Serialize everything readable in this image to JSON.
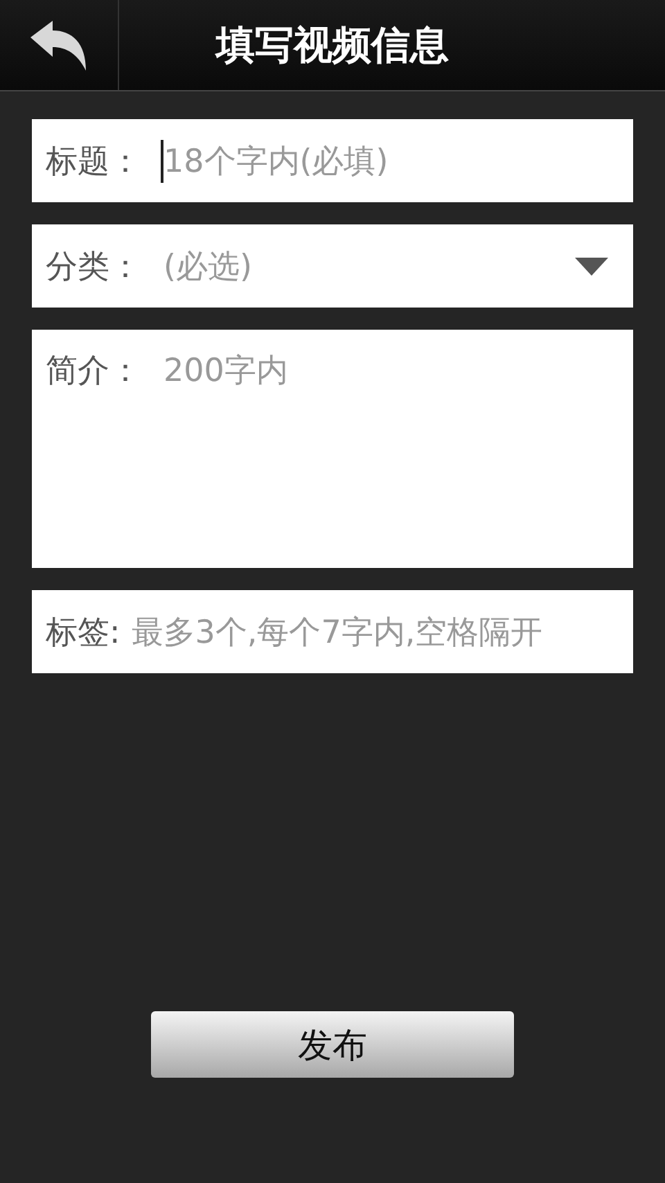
{
  "header": {
    "title": "填写视频信息"
  },
  "fields": [
    {
      "kind": "text",
      "label": "标题：",
      "placeholder": "18个字内(必填)",
      "focused": true
    },
    {
      "kind": "select",
      "label": "分类：",
      "placeholder": "(必选)",
      "focused": false
    },
    {
      "kind": "textarea",
      "label": "简介：",
      "placeholder": "200字内",
      "focused": false
    },
    {
      "kind": "text",
      "label": "标签:",
      "placeholder": "最多3个,每个7字内,空格隔开",
      "focused": false
    }
  ],
  "submit": {
    "label": "发布"
  }
}
